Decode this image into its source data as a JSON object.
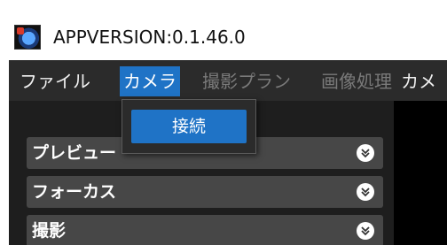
{
  "window": {
    "title": "APPVERSION:0.1.46.0"
  },
  "menubar": {
    "items": [
      {
        "label": "ファイル",
        "state": "normal"
      },
      {
        "label": "カメラ",
        "state": "active"
      },
      {
        "label": "撮影プラン",
        "state": "disabled"
      },
      {
        "label": "画像処理",
        "state": "disabled"
      },
      {
        "label": "カメ",
        "state": "normal"
      }
    ]
  },
  "dropdown": {
    "items": [
      {
        "label": "接続"
      }
    ]
  },
  "panels": [
    {
      "label": "プレビュー",
      "icon": "chevron-double-down-icon"
    },
    {
      "label": "フォーカス",
      "icon": "chevron-double-down-icon"
    },
    {
      "label": "撮影",
      "icon": "chevron-double-down-icon"
    }
  ],
  "colors": {
    "menu_active": "#1f73c6",
    "menubar_bg": "#2b2b2b",
    "panel_bg": "#474747"
  }
}
